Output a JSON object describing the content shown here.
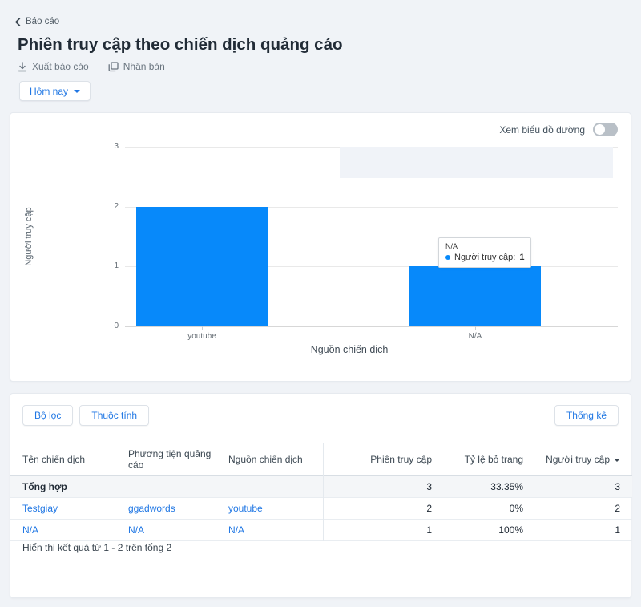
{
  "header": {
    "breadcrumb": "Báo cáo",
    "title": "Phiên truy cập theo chiến dịch quảng cáo",
    "export_label": "Xuất báo cáo",
    "duplicate_label": "Nhân bản",
    "date_filter_label": "Hôm nay"
  },
  "chart_card": {
    "line_toggle_label": "Xem biểu đồ đường",
    "line_toggle_on": false,
    "tooltip": {
      "title": "N/A",
      "series_label": "Người truy cập:",
      "value": "1"
    }
  },
  "chart_data": {
    "type": "bar",
    "title": "",
    "categories": [
      "youtube",
      "N/A"
    ],
    "series": [
      {
        "name": "Người truy cập",
        "values": [
          2,
          1
        ]
      }
    ],
    "xlabel": "Nguồn chiến dịch",
    "ylabel": "Người truy cập",
    "ylim": [
      0,
      3
    ],
    "yticks": [
      0,
      1,
      2,
      3
    ],
    "grid": true,
    "legend": "none",
    "bar_color": "#0789fa"
  },
  "table_card": {
    "filter_button_label": "Bộ lọc",
    "attributes_button_label": "Thuộc tính",
    "stats_button_label": "Thống kê",
    "columns": [
      "Tên chiến dịch",
      "Phương tiện quảng cáo",
      "Nguồn chiến dịch",
      "Phiên truy cập",
      "Tỷ lệ bỏ trang",
      "Người truy cập"
    ],
    "sorted_column": "Người truy cập",
    "sort_direction": "desc",
    "summary_row": {
      "name": "Tổng hợp",
      "sessions": "3",
      "bounce_rate": "33.35%",
      "visitors": "3"
    },
    "rows": [
      {
        "name": "Testgiay",
        "medium": "ggadwords",
        "source": "youtube",
        "sessions": "2",
        "bounce_rate": "0%",
        "visitors": "2"
      },
      {
        "name": "N/A",
        "medium": "N/A",
        "source": "N/A",
        "sessions": "1",
        "bounce_rate": "100%",
        "visitors": "1"
      }
    ],
    "footer": "Hiển thị kết quả từ 1 - 2 trên tổng 2"
  },
  "colors": {
    "accent": "#2077e4",
    "bar": "#0789fa",
    "page_bg": "#f0f3f7",
    "summary_row_bg": "#f4f6f8"
  }
}
